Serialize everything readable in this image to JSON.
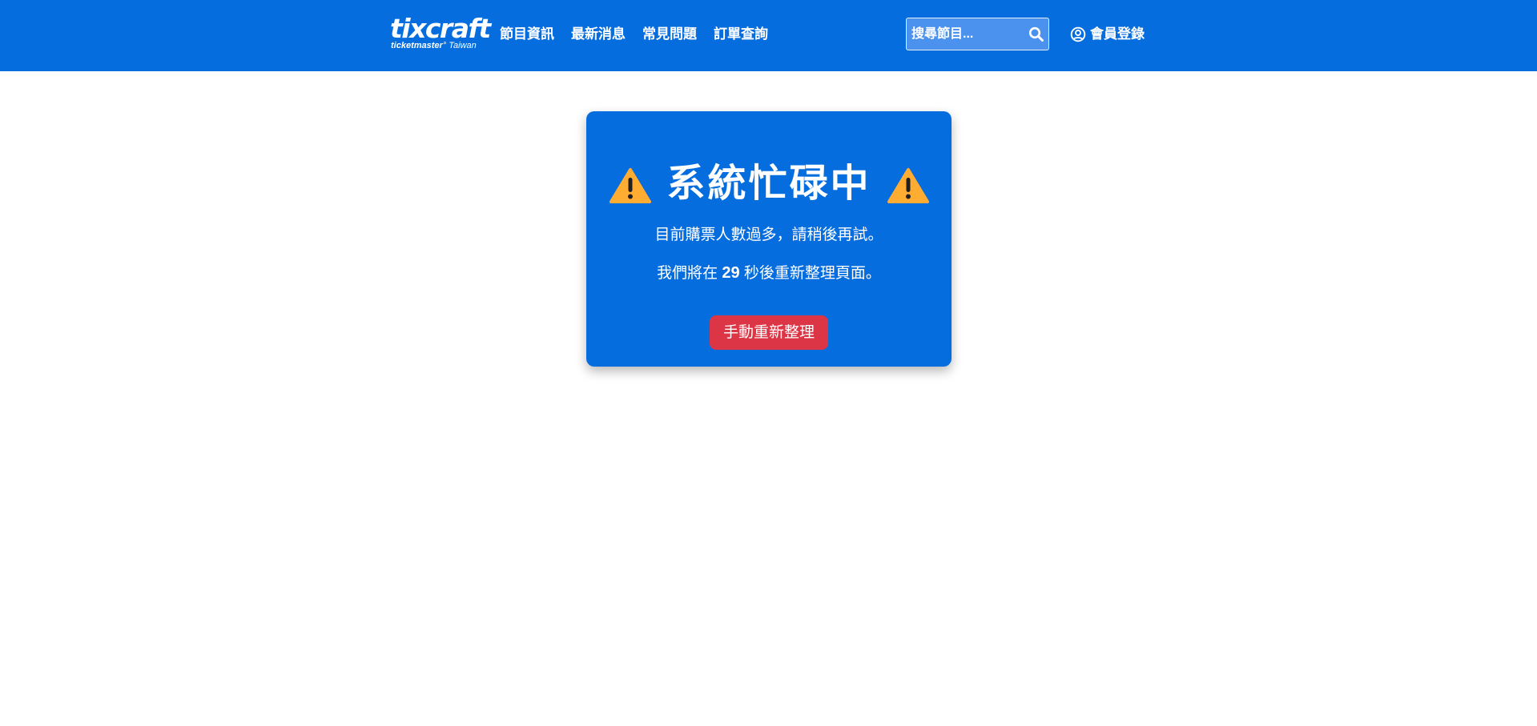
{
  "header": {
    "logo": {
      "main": "tixcraft",
      "sub_brand": "ticketmaster",
      "sub_region": "Taiwan"
    },
    "nav": [
      {
        "label": "節目資訊"
      },
      {
        "label": "最新消息"
      },
      {
        "label": "常見問題"
      },
      {
        "label": "訂單查詢"
      }
    ],
    "search": {
      "placeholder": "搜尋節目...",
      "value": "",
      "icon": "search-icon"
    },
    "login": {
      "label": "會員登錄",
      "icon": "user-circle-icon"
    }
  },
  "busy_card": {
    "title": "系統忙碌中",
    "title_icon": "warning-triangle-icon",
    "message": "目前購票人數過多，請稍後再試。",
    "countdown_prefix": "我們將在",
    "countdown_seconds": "29",
    "countdown_suffix": "秒後重新整理頁面。",
    "refresh_button": "手動重新整理"
  },
  "colors": {
    "header_bg": "#066ddf",
    "card_bg": "#066ddf",
    "search_bg": "#4a92ee",
    "warning_yellow": "#ffac33",
    "button_red": "#dc3545",
    "text": "#ffffff"
  }
}
